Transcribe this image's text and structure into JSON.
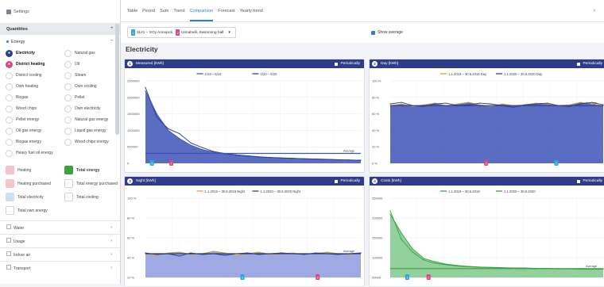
{
  "sidebar": {
    "settings_label": "Settings",
    "quantities_label": "Quantities",
    "energy_label": "Energy",
    "energy_items": [
      {
        "label": "Electricity",
        "color": "#2f3c8c",
        "selected": true,
        "icon": "bolt-icon"
      },
      {
        "label": "Natural gas",
        "color": "#fff",
        "selected": false,
        "icon": "flame-icon"
      },
      {
        "label": "District heating",
        "color": "#e0457b",
        "selected": true,
        "icon": "heat-icon"
      },
      {
        "label": "Oil",
        "color": "#fff",
        "selected": false,
        "icon": "oil-icon"
      },
      {
        "label": "District cooling",
        "color": "#fff",
        "selected": false,
        "icon": "snow-icon"
      },
      {
        "label": "Steam",
        "color": "#fff",
        "selected": false,
        "icon": "steam-icon"
      },
      {
        "label": "Own heating",
        "color": "#fff",
        "selected": false,
        "icon": "heat-icon"
      },
      {
        "label": "Own cooling",
        "color": "#fff",
        "selected": false,
        "icon": "snow-icon"
      },
      {
        "label": "Biogas",
        "color": "#fff",
        "selected": false,
        "icon": "leaf-icon"
      },
      {
        "label": "Pellet",
        "color": "#fff",
        "selected": false,
        "icon": "pellet-icon"
      },
      {
        "label": "Wood chips",
        "color": "#fff",
        "selected": false,
        "icon": "wood-icon"
      },
      {
        "label": "Own electricity",
        "color": "#fff",
        "selected": false,
        "icon": "bolt-icon"
      },
      {
        "label": "Pellet energy",
        "color": "#fff",
        "selected": false,
        "icon": "pellet-icon"
      },
      {
        "label": "Natural gas energy",
        "color": "#fff",
        "selected": false,
        "icon": "flame-icon"
      },
      {
        "label": "Oil gas energy",
        "color": "#fff",
        "selected": false,
        "icon": "oil-icon"
      },
      {
        "label": "Liquid gas energy",
        "color": "#fff",
        "selected": false,
        "icon": "flame-icon"
      },
      {
        "label": "Biogas energy",
        "color": "#fff",
        "selected": false,
        "icon": "leaf-icon"
      },
      {
        "label": "Wood chips energy",
        "color": "#fff",
        "selected": false,
        "icon": "wood-icon"
      },
      {
        "label": "Heavy fuel oil energy",
        "color": "#fff",
        "selected": false,
        "icon": "oil-icon"
      }
    ],
    "total_items": [
      {
        "label": "Heating",
        "color": "#f5c4c9",
        "selected": false
      },
      {
        "label": "Total energy",
        "color": "#3aa043",
        "selected": true
      },
      {
        "label": "Heating purchased",
        "color": "#f5c4c9",
        "selected": false
      },
      {
        "label": "Total energy purchased",
        "color": "#fff",
        "selected": false
      },
      {
        "label": "Total electricity",
        "color": "#cfe0f5",
        "selected": false
      },
      {
        "label": "Total cooling",
        "color": "#fff",
        "selected": false
      },
      {
        "label": "Total own energy",
        "color": "#fff",
        "selected": false
      }
    ],
    "sections": [
      "Water",
      "Usage",
      "Indoor air",
      "Transport"
    ]
  },
  "tabs": {
    "items": [
      "Table",
      "Period",
      "Sum",
      "Trend",
      "Comparison",
      "Forecast",
      "Yearly trend"
    ],
    "active": "Comparison",
    "close_label": "⨯"
  },
  "filter": {
    "site_tag_1": "1",
    "site_tag_2": "2",
    "site_label_1": "1121 – XOy Annopoli,",
    "site_label_2": "Uimahalli, Swimming hall",
    "show_average": "Show average"
  },
  "heading": "Electricity",
  "colors": {
    "header": "#2f3c8c",
    "series_dark": "#2f3c8c",
    "series_fill": "#3e52b8",
    "olive": "#c9a227",
    "green": "#3aa043",
    "pink": "#e0457b",
    "cyan": "#2ba8e0"
  },
  "charts": [
    {
      "header": "Measured [kWh]",
      "periodic": "Periodically",
      "num": "1",
      "legend": [
        "1/19 – 6/19",
        "1/20 – 6/20"
      ],
      "yticks": [
        "2500000",
        "2000000",
        "1500000",
        "1000000",
        "500000",
        "0"
      ],
      "avg_label": "Average",
      "markers": [
        "1",
        "2"
      ]
    },
    {
      "header": "Day [kWh]",
      "periodic": "Periodically",
      "num": "2",
      "legend": [
        "1.1.2019 – 30.6.2019 Day",
        "1.1.2020 – 30.6.2020 Day"
      ],
      "yticks": [
        "100 %",
        "80 %",
        "60 %",
        "40 %",
        "20 %",
        "0 %"
      ],
      "avg_label": "Average",
      "markers": [
        "2",
        "1"
      ]
    },
    {
      "header": "Night [kWh]",
      "periodic": "Periodically",
      "num": "3",
      "legend": [
        "1.1.2019 – 30.6.2019 Night",
        "1.1.2020 – 30.6.2020 Night"
      ],
      "yticks": [
        "100 %",
        "80 %",
        "60 %",
        "40 %",
        "20 %"
      ],
      "avg_label": "Average",
      "markers": [
        "1",
        "2"
      ]
    },
    {
      "header": "Costs [kWh]",
      "periodic": "Periodically",
      "num": "4",
      "legend": [
        "1.1.2019 – 30.6.2019",
        "1.1.2020 – 30.6.2020"
      ],
      "yticks": [
        "250000",
        "200000",
        "150000",
        "100000",
        "50000"
      ],
      "avg_label": "Average",
      "markers": [
        "1",
        "2"
      ]
    }
  ],
  "chart_data": [
    {
      "type": "area",
      "title": "Measured [kWh]",
      "ylim": [
        0,
        2500000
      ],
      "series": [
        {
          "name": "1/19 – 6/19",
          "values": [
            2200000,
            1500000,
            1000000,
            750000,
            550000,
            420000,
            340000,
            280000,
            240000,
            210000,
            190000,
            175000,
            160000,
            150000,
            140000,
            130000,
            120000,
            110000,
            100000,
            90000
          ]
        },
        {
          "name": "1/20 – 6/20",
          "values": [
            2300000,
            1400000,
            1050000,
            900000,
            620000,
            480000,
            360000,
            300000,
            260000,
            230000,
            200000,
            180000,
            165000,
            150000,
            140000,
            130000,
            120000,
            110000,
            100000,
            95000
          ]
        }
      ]
    },
    {
      "type": "area",
      "title": "Day [kWh]",
      "ylim": [
        0,
        100
      ],
      "series": [
        {
          "name": "1.1.2019 – 30.6.2019 Day",
          "values": [
            70,
            72,
            69,
            71,
            73,
            70,
            72,
            74,
            71,
            69,
            72,
            70,
            71,
            73,
            72,
            70,
            71,
            74,
            72,
            70
          ]
        },
        {
          "name": "1.1.2020 – 30.6.2020 Day",
          "values": [
            72,
            74,
            70,
            69,
            72,
            73,
            70,
            71,
            73,
            72,
            70,
            68,
            71,
            72,
            73,
            70,
            69,
            72,
            74,
            71
          ]
        }
      ]
    },
    {
      "type": "area",
      "title": "Night [kWh]",
      "ylim": [
        0,
        100
      ],
      "series": [
        {
          "name": "1.1.2019 – 30.6.2019 Night",
          "values": [
            30,
            28,
            31,
            32,
            29,
            30,
            33,
            31,
            28,
            30,
            32,
            29,
            30,
            31,
            29,
            30,
            32,
            30,
            29,
            31
          ]
        },
        {
          "name": "1.1.2020 – 30.6.2020 Night",
          "values": [
            31,
            29,
            30,
            27,
            31,
            29,
            30,
            28,
            30,
            31,
            29,
            30,
            31,
            30,
            29,
            31,
            30,
            29,
            30,
            31
          ]
        }
      ]
    },
    {
      "type": "area",
      "title": "Costs [kWh]",
      "ylim": [
        0,
        250000
      ],
      "series": [
        {
          "name": "1.1.2019 – 30.6.2019",
          "values": [
            200000,
            140000,
            90000,
            60000,
            50000,
            42000,
            38000,
            35000,
            33000,
            32000,
            31000,
            30000,
            30000,
            29000,
            29000,
            28000,
            28000,
            28000,
            27000,
            27000
          ]
        },
        {
          "name": "1.1.2020 – 30.6.2020",
          "values": [
            210000,
            120000,
            80000,
            55000,
            45000,
            40000,
            36000,
            34000,
            32000,
            31000,
            30000,
            29000,
            29000,
            28000,
            28000,
            27000,
            27000,
            26000,
            26000,
            26000
          ]
        }
      ]
    }
  ]
}
